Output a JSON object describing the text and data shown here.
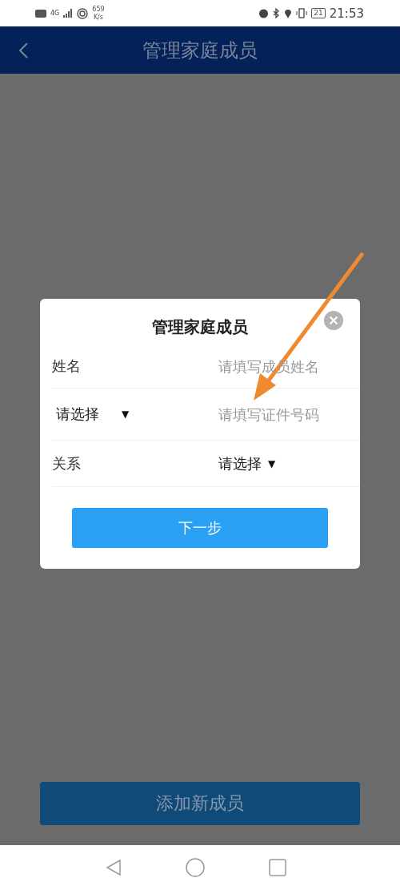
{
  "status_bar": {
    "network": "4G",
    "speed": "659",
    "speed_unit": "K/s",
    "battery": "21",
    "time": "21:53"
  },
  "header": {
    "title": "管理家庭成员"
  },
  "dialog": {
    "title": "管理家庭成员",
    "rows": [
      {
        "kind": "input",
        "label": "姓名",
        "placeholder": "请填写成员姓名"
      },
      {
        "kind": "select-input",
        "select": "请选择",
        "caret": "▼",
        "placeholder": "请填写证件号码"
      },
      {
        "kind": "select",
        "label": "关系",
        "select": "请选择",
        "caret": "▼"
      }
    ],
    "button": "下一步"
  },
  "footer_button": "添加新成员"
}
